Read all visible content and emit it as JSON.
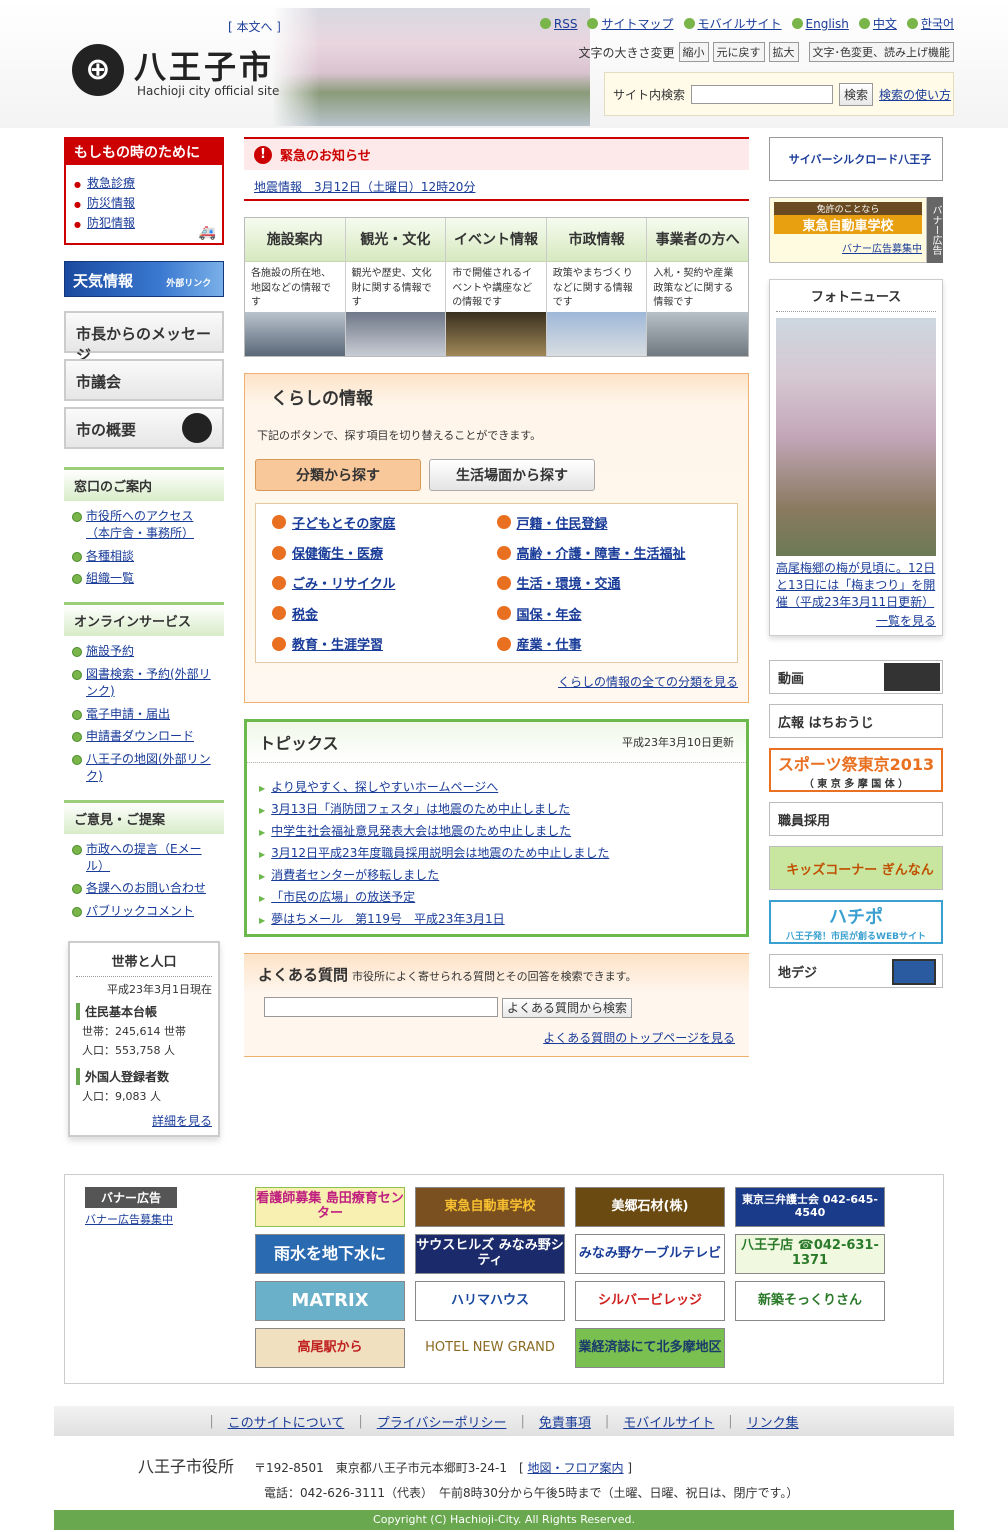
{
  "header": {
    "honbun": "[ 本文へ ]",
    "logo_mark": "⊕",
    "city_name": "八王子市",
    "city_sub": "Hachioji city official site",
    "links": [
      "RSS",
      "サイトマップ",
      "モバイルサイト",
      "English",
      "中文",
      "한국어"
    ],
    "font_label": "文字の大きさ変更",
    "font_buttons": [
      "縮小",
      "元に戻す",
      "拡大"
    ],
    "color_button": "文字･色変更、読み上げ機能",
    "search_label": "サイト内検索",
    "search_button": "検索",
    "search_help": "検索の使い方"
  },
  "left": {
    "emergency_title": "もしもの時のために",
    "emergency_items": [
      "救急診療",
      "防災情報",
      "防犯情報"
    ],
    "weather": "天気情報",
    "weather_tag": "外部リンク",
    "menu": [
      "市長からのメッセージ",
      "市議会",
      "市の概要"
    ],
    "madoguchi": {
      "title": "窓口のご案内",
      "items": [
        "市役所へのアクセス（本庁舎・事務所）",
        "各種相談",
        "組織一覧"
      ]
    },
    "online": {
      "title": "オンラインサービス",
      "items": [
        "施設予約",
        "図書検索・予約(外部リンク)",
        "電子申請・届出",
        "申請書ダウンロード",
        "八王子の地図(外部リンク)"
      ]
    },
    "opinion": {
      "title": "ご意見・ご提案",
      "items": [
        "市政への提言（Eメール）",
        "各課へのお問い合わせ",
        "パブリックコメント"
      ]
    },
    "pop": {
      "title": "世帯と人口",
      "date": "平成23年3月1日現在",
      "s1": "住民基本台帳",
      "setai": "世帯：245,614 世帯",
      "jinko": "人口：553,758 人",
      "s2": "外国人登録者数",
      "fjinko": "人口：9,083 人",
      "more": "詳細を見る"
    }
  },
  "center": {
    "urgent_title": "緊急のお知らせ",
    "urgent_link": "地震情報　3月12日（土曜日）12時20分",
    "tabs": [
      {
        "t": "施設案内",
        "d": "各施設の所在地、地図などの情報です"
      },
      {
        "t": "観光・文化",
        "d": "観光や歴史、文化財に関する情報です"
      },
      {
        "t": "イベント情報",
        "d": "市で開催されるイベントや講座などの情報です"
      },
      {
        "t": "市政情報",
        "d": "政策やまちづくりなどに関する情報です"
      },
      {
        "t": "事業者の方へ",
        "d": "入札・契約や産業政策などに関する情報です"
      }
    ],
    "kurashi": {
      "title": "くらしの情報",
      "note": "下記のボタンで、探す項目を切り替えることができます。",
      "btn1": "分類から探す",
      "btn2": "生活場面から探す",
      "cats": [
        "子どもとその家庭",
        "戸籍・住民登録",
        "保健衛生・医療",
        "高齢・介護・障害・生活福祉",
        "ごみ・リサイクル",
        "生活・環境・交通",
        "税金",
        "国保・年金",
        "教育・生涯学習",
        "産業・仕事"
      ],
      "more": "くらしの情報の全ての分類を見る"
    },
    "topics": {
      "title": "トピックス",
      "date": "平成23年3月10日更新",
      "items": [
        "より見やすく、探しやすいホームページへ",
        "3月13日「消防団フェスタ」は地震のため中止しました",
        "中学生社会福祉意見発表大会は地震のため中止しました",
        "3月12日平成23年度職員採用説明会は地震のため中止しました",
        "消費者センターが移転しました",
        "「市民の広場」の放送予定",
        "夢はちメール　第119号　平成23年3月1日"
      ]
    },
    "faq": {
      "title": "よくある質問",
      "desc": "市役所によく寄せられる質問とその回答を検索できます。",
      "button": "よくある質問から検索",
      "more": "よくある質問のトップページを見る"
    }
  },
  "right": {
    "cyber": "サイバーシルクロード八王子",
    "ad_title": "東急自動車学校",
    "ad_sub": "免許のことなら",
    "ad_side": "バナー広告",
    "ad_rec": "バナー広告募集中",
    "photo_title": "フォトニュース",
    "photo_cap": "高尾梅郷の梅が見頃に。12日と13日には「梅まつり」を開催（平成23年3月11日更新）",
    "photo_more": "一覧を見る",
    "banners": [
      "動画",
      "広報 はちおうじ",
      "スポーツ祭東京2013",
      "（ 東 京 多 摩 国 体 ）",
      "職員採用",
      "キッズコーナー ぎんなん",
      "ハチポ",
      "八王子発！市民が創るWEBサイト",
      "地デジ"
    ]
  },
  "ads": {
    "label": "バナー広告",
    "recruit": "バナー広告募集中",
    "items": [
      "看護師募集 島田療育センター",
      "東急自動車学校",
      "美郷石材(株)",
      "東京三弁護士会 042-645-4540",
      "雨水を地下水に",
      "サウスヒルズ みなみ野シティ",
      "みなみ野ケーブルテレビ",
      "八王子店 ☎042-631-1371",
      "MATRIX",
      "ハリマハウス",
      "シルバービレッジ",
      "新築そっくりさん",
      "高尾駅から",
      "HOTEL NEW GRAND",
      "業経済誌にて北多摩地区"
    ]
  },
  "footer": {
    "nav": [
      "このサイトについて",
      "プライバシーポリシー",
      "免責事項",
      "モバイルサイト",
      "リンク集"
    ],
    "office": "八王子市役所",
    "addr": "〒192-8501　東京都八王子市元本郷町3-24-1",
    "map": "地図・フロア案内",
    "tel": "電話：042-626-3111（代表）　午前8時30分から午後5時まで（土曜、日曜、祝日は、閉庁です。）",
    "copyright": "Copyright (C) Hachioji-City. All Rights Reserved."
  },
  "colors": {
    "accent_green": "#6aa84f",
    "alert_red": "#cc0000",
    "orange": "#e87020"
  }
}
